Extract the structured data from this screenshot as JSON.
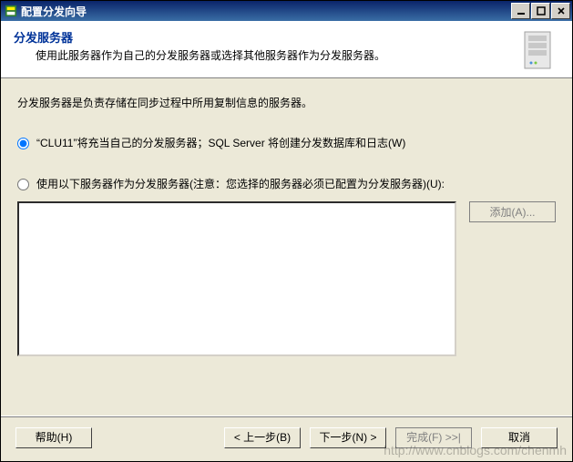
{
  "window": {
    "title": "配置分发向导"
  },
  "header": {
    "title": "分发服务器",
    "subtitle": "使用此服务器作为自己的分发服务器或选择其他服务器作为分发服务器。"
  },
  "body": {
    "description": "分发服务器是负责存储在同步过程中所用复制信息的服务器。",
    "option1_label": "“CLU11”将充当自己的分发服务器；SQL Server 将创建分发数据库和日志(W)",
    "option2_label": "使用以下服务器作为分发服务器(注意：您选择的服务器必须已配置为分发服务器)(U):",
    "selected_option": "option1",
    "add_button": "添加(A)..."
  },
  "buttons": {
    "help": "帮助(H)",
    "back": "< 上一步(B)",
    "next": "下一步(N) >",
    "finish": "完成(F) >>|",
    "cancel": "取消"
  },
  "watermark": "http://www.cnblogs.com/chenmh"
}
